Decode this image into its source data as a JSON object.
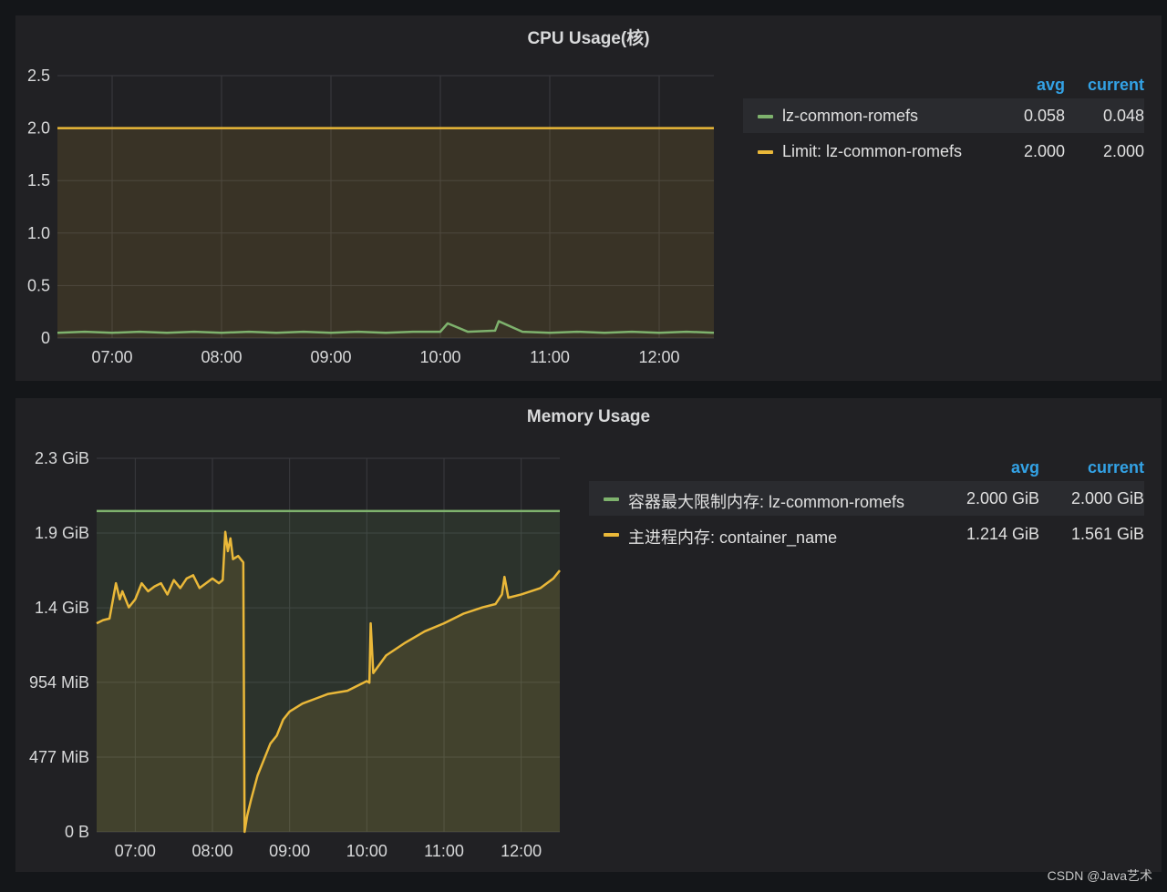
{
  "panels": {
    "cpu": {
      "title": "CPU Usage(核)",
      "legend": {
        "headers": [
          "avg",
          "current"
        ],
        "rows": [
          {
            "name": "lz-common-romefs",
            "avg": "0.058",
            "current": "0.048",
            "color": "#7eb26d"
          },
          {
            "name": "Limit: lz-common-romefs",
            "avg": "2.000",
            "current": "2.000",
            "color": "#eab839"
          }
        ]
      }
    },
    "memory": {
      "title": "Memory Usage",
      "legend": {
        "headers": [
          "avg",
          "current"
        ],
        "rows": [
          {
            "name": "容器最大限制内存: lz-common-romefs",
            "avg": "2.000 GiB",
            "current": "2.000 GiB",
            "color": "#7eb26d"
          },
          {
            "name": "主进程内存: container_name",
            "avg": "1.214 GiB",
            "current": "1.561 GiB",
            "color": "#eab839"
          }
        ]
      }
    }
  },
  "watermark": "CSDN @Java艺术",
  "chart_data": [
    {
      "type": "line",
      "title": "CPU Usage(核)",
      "x_unit": "time",
      "xlim": [
        "06:30",
        "12:30"
      ],
      "x_ticks": [
        "07:00",
        "08:00",
        "09:00",
        "10:00",
        "11:00",
        "12:00"
      ],
      "y_ticks": [
        "0",
        "0.5",
        "1.0",
        "1.5",
        "2.0",
        "2.5"
      ],
      "y_tick_values": [
        0,
        0.5,
        1.0,
        1.5,
        2.0,
        2.5
      ],
      "ylim": [
        0,
        2.5
      ],
      "grid": true,
      "legend_position": "right",
      "series": [
        {
          "name": "lz-common-romefs",
          "color": "#7eb26d",
          "fill": false,
          "x": [
            "06:30",
            "06:45",
            "07:00",
            "07:15",
            "07:30",
            "07:45",
            "08:00",
            "08:15",
            "08:30",
            "08:45",
            "09:00",
            "09:15",
            "09:30",
            "09:45",
            "10:00",
            "10:04",
            "10:15",
            "10:30",
            "10:32",
            "10:45",
            "11:00",
            "11:15",
            "11:30",
            "11:45",
            "12:00",
            "12:15",
            "12:30"
          ],
          "y": [
            0.05,
            0.06,
            0.05,
            0.06,
            0.05,
            0.06,
            0.05,
            0.06,
            0.05,
            0.06,
            0.05,
            0.06,
            0.05,
            0.06,
            0.06,
            0.14,
            0.06,
            0.07,
            0.16,
            0.06,
            0.05,
            0.06,
            0.05,
            0.06,
            0.05,
            0.06,
            0.05
          ]
        },
        {
          "name": "Limit: lz-common-romefs",
          "color": "#eab839",
          "fill": true,
          "x": [
            "06:30",
            "12:30"
          ],
          "y": [
            2.0,
            2.0
          ]
        }
      ]
    },
    {
      "type": "line",
      "title": "Memory Usage",
      "x_unit": "time",
      "y_unit": "GiB",
      "xlim": [
        "06:30",
        "12:30"
      ],
      "x_ticks": [
        "07:00",
        "08:00",
        "09:00",
        "10:00",
        "11:00",
        "12:00"
      ],
      "y_ticks": [
        "0 B",
        "477 MiB",
        "954 MiB",
        "1.4 GiB",
        "1.9 GiB",
        "2.3 GiB"
      ],
      "y_tick_values": [
        0,
        0.466,
        0.932,
        1.397,
        1.863,
        2.329
      ],
      "ylim": [
        0,
        2.329
      ],
      "grid": true,
      "legend_position": "right",
      "series": [
        {
          "name": "容器最大限制内存: lz-common-romefs",
          "color": "#7eb26d",
          "fill": true,
          "x": [
            "06:30",
            "12:30"
          ],
          "y": [
            2.0,
            2.0
          ]
        },
        {
          "name": "主进程内存: container_name",
          "color": "#eab839",
          "fill": true,
          "x": [
            "06:30",
            "06:35",
            "06:40",
            "06:45",
            "06:48",
            "06:50",
            "06:55",
            "07:00",
            "07:05",
            "07:10",
            "07:15",
            "07:20",
            "07:25",
            "07:30",
            "07:35",
            "07:40",
            "07:45",
            "07:50",
            "07:55",
            "08:00",
            "08:05",
            "08:08",
            "08:10",
            "08:12",
            "08:14",
            "08:16",
            "08:20",
            "08:24",
            "08:25",
            "08:27",
            "08:30",
            "08:35",
            "08:40",
            "08:45",
            "08:50",
            "08:55",
            "09:00",
            "09:10",
            "09:20",
            "09:30",
            "09:45",
            "10:00",
            "10:02",
            "10:03",
            "10:05",
            "10:15",
            "10:30",
            "10:45",
            "11:00",
            "11:15",
            "11:30",
            "11:40",
            "11:45",
            "11:47",
            "11:50",
            "12:00",
            "12:15",
            "12:20",
            "12:25",
            "12:30"
          ],
          "y": [
            1.3,
            1.32,
            1.33,
            1.55,
            1.45,
            1.5,
            1.4,
            1.45,
            1.55,
            1.5,
            1.53,
            1.55,
            1.48,
            1.57,
            1.52,
            1.58,
            1.6,
            1.52,
            1.55,
            1.58,
            1.55,
            1.57,
            1.87,
            1.75,
            1.83,
            1.7,
            1.72,
            1.68,
            0.0,
            0.1,
            0.2,
            0.35,
            0.45,
            0.55,
            0.6,
            0.7,
            0.75,
            0.8,
            0.83,
            0.86,
            0.88,
            0.94,
            0.93,
            1.3,
            0.99,
            1.1,
            1.18,
            1.25,
            1.3,
            1.36,
            1.4,
            1.42,
            1.48,
            1.59,
            1.46,
            1.48,
            1.52,
            1.55,
            1.58,
            1.63
          ]
        }
      ]
    }
  ]
}
